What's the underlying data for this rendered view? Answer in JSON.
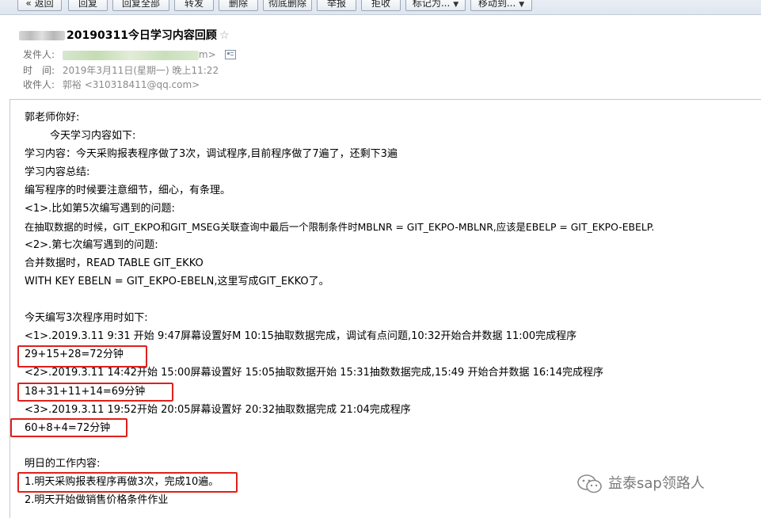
{
  "toolbar": {
    "buttons": [
      "返回",
      "回复",
      "回复全部",
      "转发",
      "删除",
      "彻底删除",
      "举报",
      "拒收",
      "标记为...",
      "移动到..."
    ]
  },
  "email": {
    "subject": "20190311今日学习内容回顾",
    "from_label": "发件人:",
    "from_value_suffix": "m>",
    "time_label": "时　间:",
    "time_value": "2019年3月11日(星期一) 晚上11:22",
    "to_label": "收件人:",
    "to_value": "郭裕 <310318411@qq.com>"
  },
  "body": {
    "lines": [
      "郭老师你好:",
      "今天学习内容如下:",
      "学习内容：今天采购报表程序做了3次，调试程序,目前程序做了7遍了，还剩下3遍",
      "学习内容总结:",
      "编写程序的时候要注意细节，细心，有条理。",
      "<1>.比如第5次编写遇到的问题:",
      "在抽取数据的时候，GIT_EKPO和GIT_MSEG关联查询中最后一个限制条件时MBLNR = GIT_EKPO-MBLNR,应该是EBELP = GIT_EKPO-EBELP.",
      "<2>.第七次编写遇到的问题:",
      "合并数据时，READ TABLE GIT_EKKO",
      "WITH KEY EBELN = GIT_EKPO-EBELN,这里写成GIT_EKKO了。",
      "今天编写3次程序用时如下:",
      "<1>.2019.3.11 9:31 开始 9:47屏幕设置好M 10:15抽取数据完成，调试有点问题,10:32开始合并数据 11:00完成程序",
      "29+15+28=72分钟",
      "<2>.2019.3.11 14:42开始 15:00屏幕设置好 15:05抽取数据开始 15:31抽数数据完成,15:49 开始合并数据  16:14完成程序",
      "18+31+11+14=69分钟",
      "<3>.2019.3.11 19:52开始 20:05屏幕设置好 20:32抽取数据完成  21:04完成程序",
      "60+8+4=72分钟",
      "明日的工作内容:",
      "1.明天采购报表程序再做3次，完成10遍。",
      "2.明天开始做销售价格条件作业"
    ]
  },
  "watermark": {
    "text": "益泰sap领路人"
  },
  "colors": {
    "highlight_box": "#e0201b",
    "meta_text": "#6d6d6d"
  }
}
